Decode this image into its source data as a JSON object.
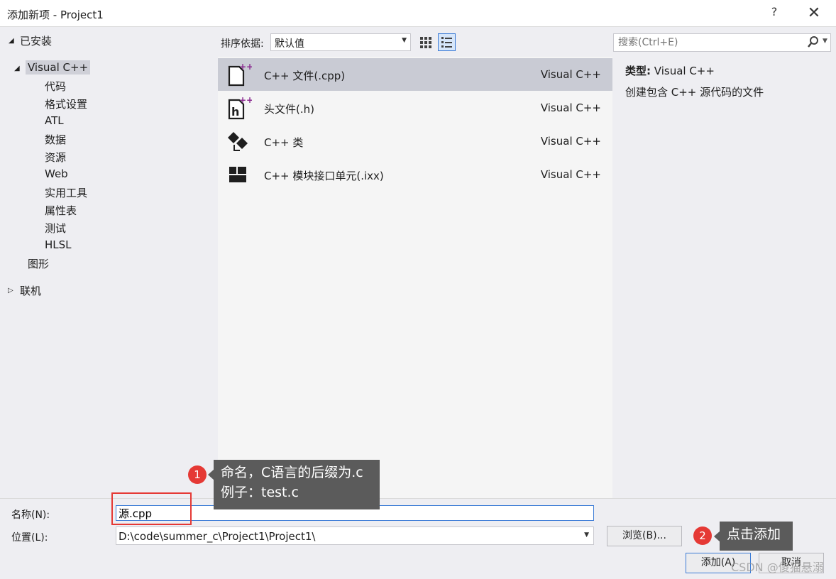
{
  "window": {
    "title": "添加新项 - Project1",
    "help_label": "?",
    "close_label": "✕"
  },
  "tree": {
    "installed_label": "已安装",
    "root_label": "Visual C++",
    "children": [
      "代码",
      "格式设置",
      "ATL",
      "数据",
      "资源",
      "Web",
      "实用工具",
      "属性表",
      "测试",
      "HLSL"
    ],
    "graphics_label": "图形",
    "online_label": "联机"
  },
  "sort": {
    "label": "排序依据:",
    "value": "默认值"
  },
  "templates": [
    {
      "name": "C++ 文件(.cpp)",
      "type": "Visual C++",
      "icon": "cpp-file-icon"
    },
    {
      "name": "头文件(.h)",
      "type": "Visual C++",
      "icon": "header-file-icon"
    },
    {
      "name": "C++ 类",
      "type": "Visual C++",
      "icon": "cpp-class-icon"
    },
    {
      "name": "C++ 模块接口单元(.ixx)",
      "type": "Visual C++",
      "icon": "module-interface-icon"
    }
  ],
  "search": {
    "placeholder": "搜索(Ctrl+E)"
  },
  "info": {
    "type_label": "类型:",
    "type_value": "Visual C++",
    "description": "创建包含 C++ 源代码的文件"
  },
  "form": {
    "name_label": "名称(N):",
    "name_value": "源.cpp",
    "location_label": "位置(L):",
    "location_value": "D:\\code\\summer_c\\Project1\\Project1\\",
    "browse_label": "浏览(B)...",
    "add_label": "添加(A)",
    "cancel_label": "取消"
  },
  "annotations": {
    "badge1": "1",
    "callout1_line1": "命名，C语言的后缀为.c",
    "callout1_line2": "例子：test.c",
    "badge2": "2",
    "callout2": "点击添加",
    "watermark": "CSDN @傻猫悬溺"
  },
  "colors": {
    "accent": "#3b7bd6",
    "annotation_red": "#e53935",
    "callout_bg": "#5b5b5b",
    "selection_bg": "#c9cbd4",
    "icon_purple": "#8a2a8f"
  }
}
